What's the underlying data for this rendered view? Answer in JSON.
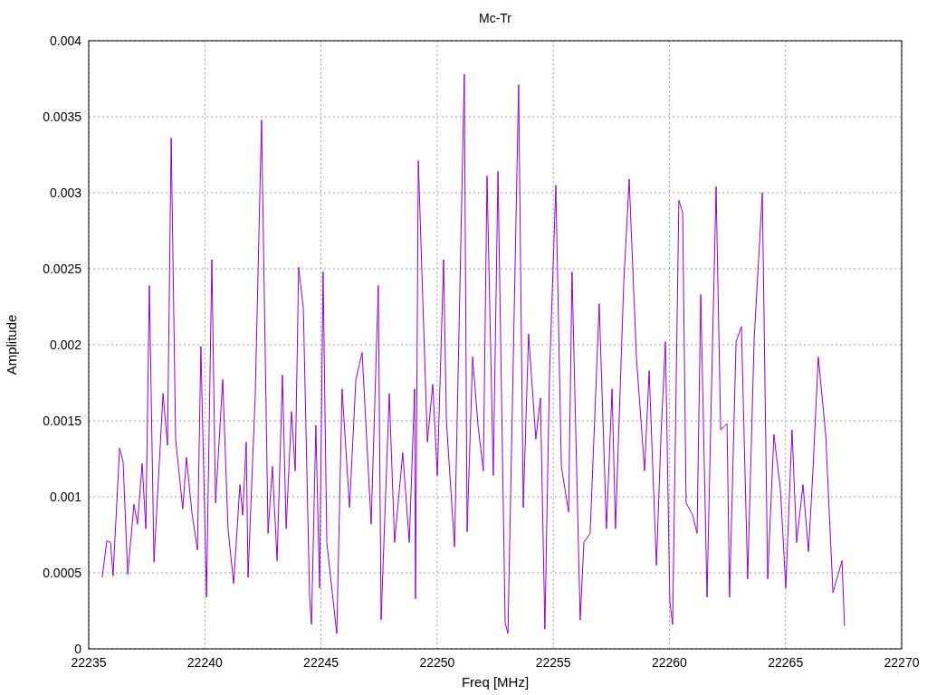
{
  "chart_data": {
    "type": "line",
    "title": "Mc-Tr",
    "xlabel": "Freq [MHz]",
    "ylabel": "Amplitude",
    "grid": true,
    "xlim": [
      22235,
      22270
    ],
    "ylim": [
      0,
      0.004
    ],
    "xticks": [
      22235,
      22240,
      22245,
      22250,
      22255,
      22260,
      22265,
      22270
    ],
    "yticks": [
      0,
      0.0005,
      0.001,
      0.0015,
      0.002,
      0.0025,
      0.003,
      0.0035,
      0.004
    ],
    "x": [
      22235.58,
      22235.78,
      22235.94,
      22236.05,
      22236.33,
      22236.48,
      22236.68,
      22236.95,
      22237.1,
      22237.3,
      22237.46,
      22237.61,
      22237.81,
      22238.2,
      22238.39,
      22238.55,
      22238.74,
      22239.05,
      22239.21,
      22239.44,
      22239.68,
      22239.83,
      22240.03,
      22240.07,
      22240.3,
      22240.46,
      22240.77,
      22241,
      22241.24,
      22241.51,
      22241.63,
      22241.78,
      22241.86,
      22242.17,
      22242.44,
      22242.72,
      22242.91,
      22243.11,
      22243.34,
      22243.5,
      22243.73,
      22243.89,
      22244.04,
      22244.24,
      22244.51,
      22244.59,
      22244.78,
      22244.94,
      22245.09,
      22245.25,
      22245.68,
      22245.91,
      22246.23,
      22246.5,
      22246.77,
      22247.16,
      22247.47,
      22247.59,
      22247.94,
      22248.17,
      22248.52,
      22248.8,
      22249.03,
      22249.07,
      22249.19,
      22249.58,
      22249.81,
      22250.01,
      22250.28,
      22250.4,
      22250.75,
      22251.17,
      22251.29,
      22251.53,
      22251.76,
      22251.99,
      22252.15,
      22252.42,
      22252.62,
      22252.93,
      22253.05,
      22253.51,
      22253.71,
      22253.94,
      22254.25,
      22254.45,
      22254.64,
      22254.84,
      22255.11,
      22255.35,
      22255.66,
      22255.81,
      22256.16,
      22256.32,
      22256.59,
      22256.98,
      22257.29,
      22257.53,
      22257.68,
      22258.03,
      22258.27,
      22258.58,
      22258.93,
      22259.13,
      22259.44,
      22259.64,
      22259.83,
      22260.02,
      22260.14,
      22260.41,
      22260.57,
      22260.72,
      22261,
      22261.19,
      22261.35,
      22261.62,
      22261.78,
      22262.01,
      22262.21,
      22262.48,
      22262.59,
      22262.87,
      22263.1,
      22263.37,
      22263.65,
      22264,
      22264.23,
      22264.5,
      22264.78,
      22265.01,
      22265.28,
      22265.48,
      22265.75,
      22265.99,
      22266.18,
      22266.41,
      22266.73,
      22267.04,
      22267.43,
      22267.54
    ],
    "series": [
      {
        "color": "#9400d3",
        "values": [
          0.00047,
          0.00071,
          0.0007,
          0.00048,
          0.00132,
          0.00123,
          0.00049,
          0.00095,
          0.00082,
          0.00122,
          0.00079,
          0.00239,
          0.00057,
          0.00168,
          0.00134,
          0.00336,
          0.00138,
          0.00092,
          0.00126,
          0.0009,
          0.00065,
          0.00199,
          0.00061,
          0.00034,
          0.00256,
          0.00096,
          0.00177,
          0.00079,
          0.00043,
          0.00108,
          0.00088,
          0.00136,
          0.00047,
          0.00168,
          0.00348,
          0.00076,
          0.0012,
          0.00058,
          0.0018,
          0.00079,
          0.00156,
          0.00117,
          0.00251,
          0.00224,
          0.00034,
          0.00016,
          0.00147,
          0.0004,
          0.00248,
          0.0007,
          0.0001,
          0.00171,
          0.00093,
          0.00177,
          0.00195,
          0.00082,
          0.00239,
          0.00019,
          0.00168,
          0.0007,
          0.00129,
          0.0007,
          0.00171,
          0.00033,
          0.00321,
          0.00136,
          0.00174,
          0.00114,
          0.00256,
          0.0015,
          0.00067,
          0.00378,
          0.00077,
          0.00192,
          0.00147,
          0.00117,
          0.00311,
          0.00114,
          0.00314,
          0.00017,
          0.0001,
          0.00371,
          0.00093,
          0.00207,
          0.00138,
          0.00165,
          0.00013,
          0.0018,
          0.00305,
          0.0012,
          0.0009,
          0.00248,
          0.00019,
          0.0007,
          0.00076,
          0.00227,
          0.00079,
          0.00171,
          0.00079,
          0.00239,
          0.00309,
          0.00192,
          0.00117,
          0.00183,
          0.00055,
          0.00141,
          0.00202,
          0.00031,
          0.00016,
          0.00295,
          0.00287,
          0.00096,
          0.00088,
          0.00076,
          0.00233,
          0.00034,
          0.00147,
          0.00304,
          0.00144,
          0.00148,
          0.00034,
          0.00202,
          0.00212,
          0.00046,
          0.00204,
          0.003,
          0.00046,
          0.00141,
          0.00105,
          0.0004,
          0.00144,
          0.0007,
          0.00108,
          0.00064,
          0.00117,
          0.00192,
          0.00141,
          0.00037,
          0.00058,
          0.00015
        ]
      }
    ]
  }
}
